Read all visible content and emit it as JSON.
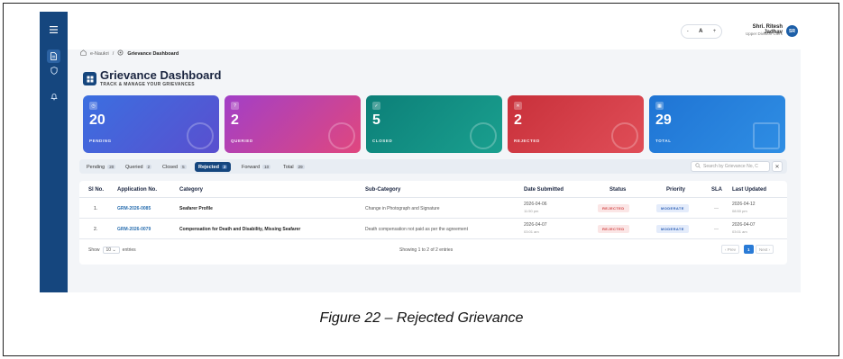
{
  "sidebar": {
    "menu_icon": "hamburger-icon",
    "items": [
      {
        "icon": "document-icon",
        "active": true
      },
      {
        "icon": "shield-icon",
        "active": false
      },
      {
        "icon": "bell-icon",
        "active": false
      }
    ]
  },
  "topbar": {
    "font_controls": [
      "-",
      "A",
      "+"
    ],
    "user_name": "Shri. Ritesh Jadhav",
    "user_role": "Upper Division Clerk",
    "avatar_initials": "SR"
  },
  "breadcrumb": {
    "home": "e-Naukri",
    "separator": "/",
    "current": "Grievance Dashboard"
  },
  "header": {
    "title": "Grievance Dashboard",
    "subtitle": "TRACK & MANAGE YOUR GRIEVANCES"
  },
  "cards": [
    {
      "value": "20",
      "label": "PENDING",
      "color_from": "#3b6fe0",
      "color_to": "#5a4fcf"
    },
    {
      "value": "2",
      "label": "QUERIED",
      "color_from": "#a23fc7",
      "color_to": "#e0477e"
    },
    {
      "value": "5",
      "label": "CLOSED",
      "color_from": "#0c7f78",
      "color_to": "#1aa08f"
    },
    {
      "value": "2",
      "label": "REJECTED",
      "color_from": "#c8303a",
      "color_to": "#e04e58"
    },
    {
      "value": "29",
      "label": "TOTAL",
      "color_from": "#1f74d4",
      "color_to": "#2f8ee4"
    }
  ],
  "tabs": [
    {
      "label": "Pending",
      "count": "20"
    },
    {
      "label": "Queried",
      "count": "2"
    },
    {
      "label": "Closed",
      "count": "5"
    },
    {
      "label": "Rejected",
      "count": "2",
      "active": true
    },
    {
      "label": "Forward",
      "count": "10"
    },
    {
      "label": "Total",
      "count": "29"
    }
  ],
  "search": {
    "placeholder": "Search by Grievance No, C"
  },
  "table": {
    "headers": [
      "Sl No.",
      "Application No.",
      "Category",
      "Sub-Category",
      "Date Submitted",
      "Status",
      "Priority",
      "SLA",
      "Last Updated"
    ],
    "rows": [
      {
        "sl": "1.",
        "app_no": "GRM-2026-0085",
        "category": "Seafarer Profile",
        "sub_category": "Change in Photograph and Signature",
        "date_submitted": "2026-04-06",
        "time_submitted": "11:50 pm",
        "status": "REJECTED",
        "priority": "MODERATE",
        "sla": "—",
        "last_updated": "2026-04-12",
        "last_updated_time": "08:50 pm"
      },
      {
        "sl": "2.",
        "app_no": "GRM-2026-0079",
        "category": "Compensation for Death and Disability, Missing Seafarer",
        "sub_category": "Death compensation not paid as per the agreement",
        "date_submitted": "2026-04-07",
        "time_submitted": "03:01 am",
        "status": "REJECTED",
        "priority": "MODERATE",
        "sla": "—",
        "last_updated": "2026-04-07",
        "last_updated_time": "03:01 am"
      }
    ],
    "footer": {
      "show_label": "Show",
      "page_size": "10",
      "entries_label": "entries",
      "showing": "Showing 1 to 2 of 2 entries",
      "prev": "‹ Prev",
      "page": "1",
      "next": "Next ›"
    }
  },
  "caption": "Figure 22 – Rejected Grievance"
}
